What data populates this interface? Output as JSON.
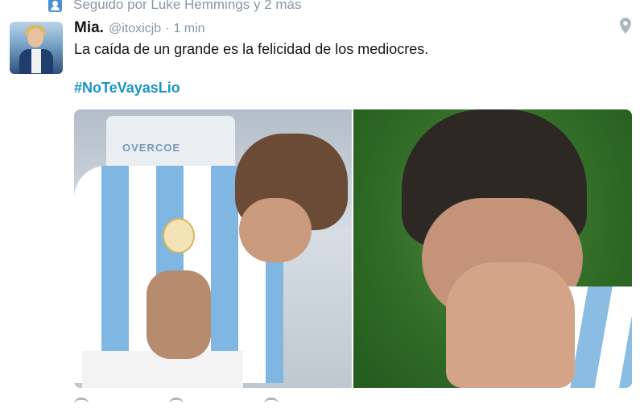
{
  "context": {
    "icon": "person-icon",
    "text": "Seguido por Luke Hemmings y 2 más"
  },
  "tweet": {
    "avatar_alt": "avatar",
    "display_name": "Mia.",
    "handle": "@itoxicjb",
    "separator": "·",
    "time": "1 min",
    "text": "La caída de un grande es la felicidad de los mediocres.",
    "hashtag": "#NoTeVayasLio",
    "location_icon": "location-pin-icon"
  },
  "media": {
    "left_seat_label": "OVERCOE",
    "photos": [
      "photo-left",
      "photo-right"
    ]
  },
  "actions": {
    "icons": [
      "reply-icon",
      "retweet-icon",
      "like-icon"
    ]
  },
  "colors": {
    "hashtag": "#1b95c6",
    "muted": "#8899a6",
    "context_icon": "#4a8fd0"
  }
}
